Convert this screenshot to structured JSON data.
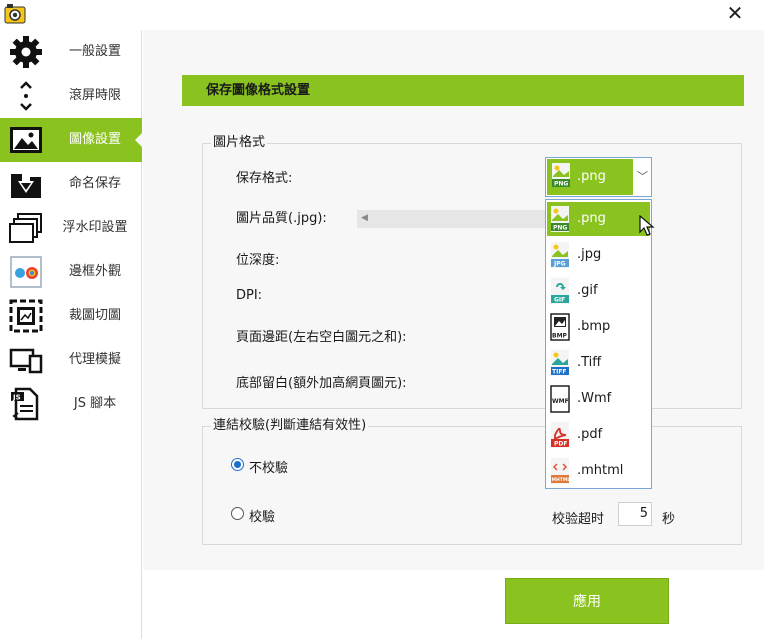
{
  "titlebar": {
    "close_symbol": "✕"
  },
  "sidebar": {
    "items": [
      {
        "label": "一般設置",
        "icon": "gear-icon"
      },
      {
        "label": "滾屏時限",
        "icon": "scroll-arrows-icon"
      },
      {
        "label": "圖像設置",
        "icon": "image-icon",
        "active": true
      },
      {
        "label": "命名保存",
        "icon": "save-folder-icon"
      },
      {
        "label": "浮水印設置",
        "icon": "watermark-layers-icon"
      },
      {
        "label": "邊框外觀",
        "icon": "browser-frame-icon"
      },
      {
        "label": "裁圖切圖",
        "icon": "crop-icon"
      },
      {
        "label": "代理模擬",
        "icon": "proxy-devices-icon"
      },
      {
        "label": "JS 腳本",
        "icon": "js-script-icon"
      }
    ]
  },
  "main": {
    "section_title": "保存圖像格式設置",
    "image_format_group": {
      "title": "圖片格式",
      "save_format_label": "保存格式:",
      "quality_label": "圖片品質(.jpg):",
      "bit_depth_label": "位深度:",
      "dpi_label": "DPI:",
      "page_margin_label": "頁面邊距(左右空白圖元之和):",
      "bottom_margin_label": "底部留白(額外加高網頁圖元):"
    },
    "selected_format": ".png",
    "format_options": [
      {
        "label": ".png",
        "icon": "png-file-icon",
        "selected": true
      },
      {
        "label": ".jpg",
        "icon": "jpg-file-icon"
      },
      {
        "label": ".gif",
        "icon": "gif-file-icon"
      },
      {
        "label": ".bmp",
        "icon": "bmp-file-icon"
      },
      {
        "label": ".Tiff",
        "icon": "tiff-file-icon"
      },
      {
        "label": ".Wmf",
        "icon": "wmf-file-icon"
      },
      {
        "label": ".pdf",
        "icon": "pdf-file-icon"
      },
      {
        "label": ".mhtml",
        "icon": "mhtml-file-icon"
      }
    ],
    "link_check_group": {
      "title": "連結校驗(判斷連結有效性)",
      "option_no_check": "不校驗",
      "option_check": "校驗",
      "selected": "不校驗",
      "timeout_label": "校验超时",
      "timeout_value": "5",
      "timeout_unit": "秒"
    }
  },
  "footer": {
    "apply_label": "應用"
  },
  "colors": {
    "accent": "#8ac220",
    "dropdown_border": "#7aa7d8",
    "radio_on": "#1a6fc9"
  }
}
